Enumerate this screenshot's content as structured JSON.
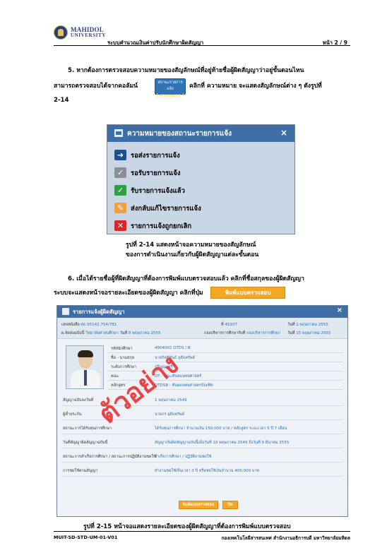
{
  "header": {
    "logo_line1": "MAHIDOL",
    "logo_line2": "UNIVERSITY",
    "system_title": "ระบบคำนวณเงินค่าปรับนักศึกษาผิดสัญญา",
    "page": "หน้า 2 / 9"
  },
  "step5": {
    "line1": "5. หากต้องการตรวจสอบความหมายของสัญลักษณ์ที่อยู่ท้ายชื่อผู้ผิดสัญญาว่าอยู่ขั้นตอนไหน",
    "line2a": "สามารถตรวจสอบได้จากคอลัมน์",
    "line2b": "คลิกที่ ความหมาย จะแสดงสัญลักษณ์ต่าง ๆ ดังรูปที่",
    "line3": "2-14",
    "button_line1": "สถานะรายการแจ้ง",
    "button_line2": "( ความหมาย )"
  },
  "legend_dialog": {
    "title": "ความหมายของสถานะรายการแจ้ง",
    "close": "×",
    "items": [
      {
        "icon": "arrow-right-icon",
        "label": "รอส่งรายการแจ้ง",
        "color": "#1f4e8c",
        "glyph": "➜"
      },
      {
        "icon": "check-grey-icon",
        "label": "รอรับรายการแจ้ง",
        "color": "#8a8f96",
        "glyph": "✓"
      },
      {
        "icon": "check-green-icon",
        "label": "รับรายการแจ้งแล้ว",
        "color": "#2f9e44",
        "glyph": "✓"
      },
      {
        "icon": "pencil-icon",
        "label": "ส่งกลับแก้ไขรายการแจ้ง",
        "color": "#f0a03a",
        "glyph": "✎"
      },
      {
        "icon": "cross-icon",
        "label": "รายการแจ้งถูกยกเลิก",
        "color": "#d62828",
        "glyph": "✕"
      }
    ]
  },
  "caption14": {
    "line1": "รูปที่ 2-14 แสดงหน้าจอความหมายของสัญลักษณ์",
    "line2": "ของการดำเนินงานเกี่ยวกับผู้ผิดสัญญาแต่ละขั้นตอน"
  },
  "step6": {
    "line1": "6. เมื่อได้รายชื่อผู้ที่ผิดสัญญาที่ต้องการพิมพ์แบบตรวจสอบแล้ว คลิกที่ชื่อสกุลของผู้ผิดสัญญา",
    "line2": "ระบบจะแสดงหน้าจอรายละเอียดของผู้ผิดสัญญา คลิกที่ปุ่ม",
    "button": "พิมพ์แบบตรวจสอบ"
  },
  "detail_dialog": {
    "title": "รายการแจ้งผู้ผิดสัญญา",
    "close": "×",
    "doc_no_label": "เลขหนังสือ",
    "doc_no": "ศธ 05142.754/781",
    "ref_label": "ที่",
    "ref": "45207",
    "date_label": "วันที่",
    "date": "1 พฤษภาคม 2555",
    "sender_label": "ผ.จัดส่งฉบับนี้",
    "sender": "วิทยาลัยศาสนศึกษา",
    "sent_date_label": "วันที่",
    "sent_date": "8 พฤษภาคม 2555",
    "receiver_label": "กองบริหารการศึกษารับที่",
    "receiver": "กองบริหารการศึกษา",
    "recv_date_label": "วันที่",
    "recv_date": "15 พฤษภาคม 2555",
    "fields": [
      {
        "label": "รหัสนักศึกษา",
        "value": "4904002 DTDS / B"
      },
      {
        "label": "ชื่อ - นามสกุล",
        "value": "นายกิตติพันธ์ อุดีบทรัพย์"
      },
      {
        "label": "ระดับการศึกษา",
        "value": "ปริญญาตรี"
      },
      {
        "label": "คณะ",
        "value": "DT - คณะทันตแพทยศาสตร์"
      },
      {
        "label": "หลักสูตร",
        "value": "DTDSB - ทันตแพทยศาสตรบัณฑิต"
      }
    ],
    "rows": [
      {
        "label": "สัญญาฉบับลงวันที่",
        "value": "1 พฤษภาคม 2549"
      },
      {
        "label": "ผู้ค้ำประกัน",
        "value": "นายกร อุดีบทรัพย์"
      },
      {
        "label": "สถานะการได้รับทุนการศึกษา",
        "value": "ได้รับทุนการศึกษา จำนวนเงิน 150,000 บาท / หลักสูตร ระยะเวลา 5 ปี 7 เดือน"
      },
      {
        "label": "วันที่สัญญาผิดสัญญาฉบับนี้",
        "value": "สัญญาเริ่มผิดสัญญาฉบับนี้เมื่อวันที่ 10 พฤษภาคม 2549 ถึงวันที่ 9 มีนาคม 2555"
      },
      {
        "label": "สถานะการสำเร็จการศึกษา / สถานะการปฏิบัติงานชดใช้",
        "value": "สำเร็จการศึกษา / ปฏิบัติงานชดใช้"
      },
      {
        "label": "การชดใช้ตามสัญญา",
        "value": "ทำงานชดใช้เป็นเวลา 3 ปี หรือชดใช้เงินจำนวน 400,000 บาท"
      }
    ],
    "btn_print": "พิมพ์แบบตรวจสอบ",
    "btn_close": "ปิด"
  },
  "watermark": "ตัวอย่าง",
  "caption15": "รูปที่ 2-15 หน้าจอแสดงรายละเอียดของผู้ผิดสัญญาที่ต้องการพิมพ์แบบตรวจสอบ",
  "footer": {
    "doc_code": "MUIT-SD-STD-UM-01-V01",
    "org": "กองเทคโนโลยีสารสนเทศ สำนักงานอธิการบดี มหาวิทยาลัยมหิดล"
  }
}
